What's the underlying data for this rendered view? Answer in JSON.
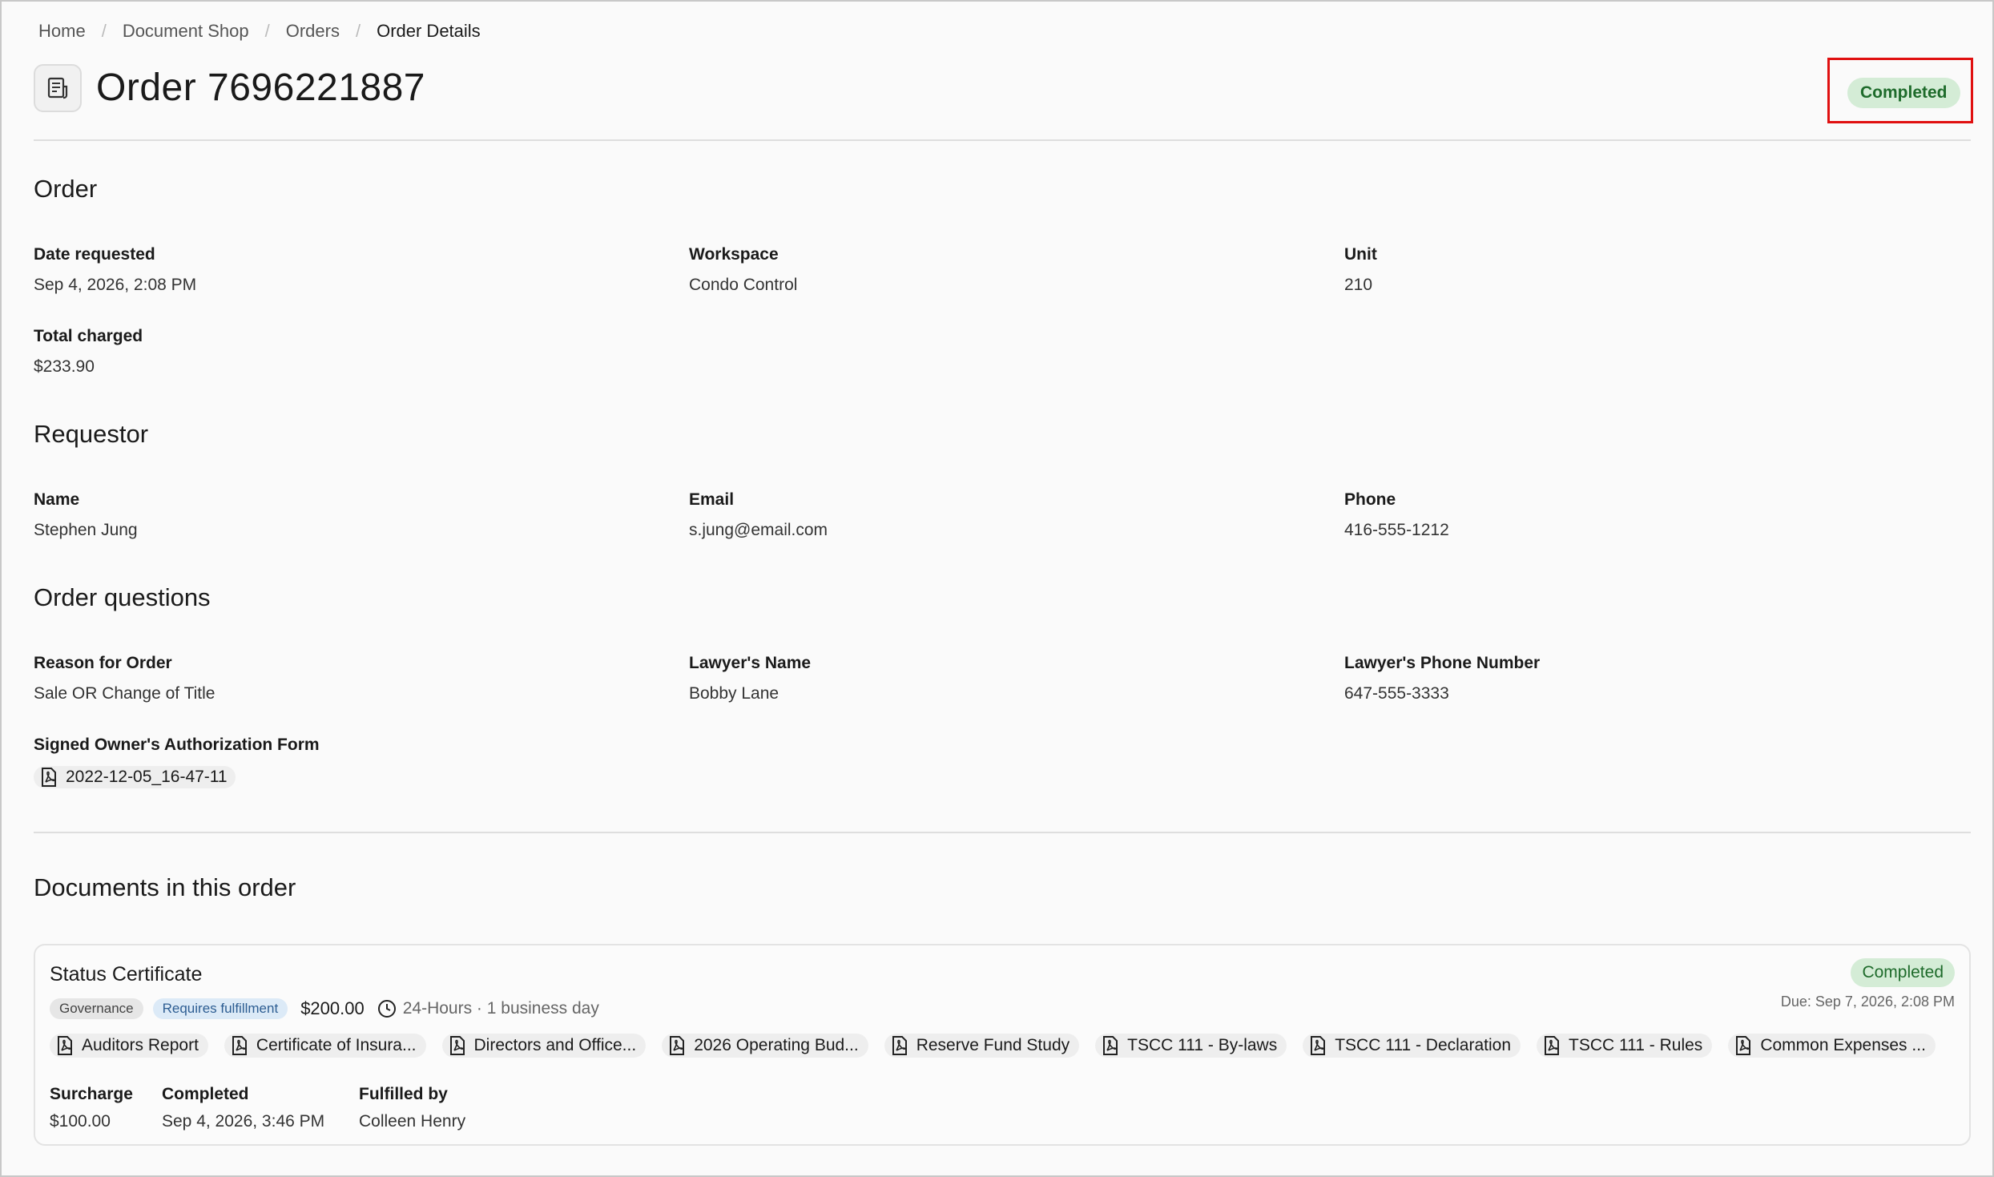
{
  "breadcrumb": {
    "items": [
      "Home",
      "Document Shop",
      "Orders"
    ],
    "current": "Order Details"
  },
  "header": {
    "title": "Order 7696221887",
    "status": "Completed",
    "icon": "document-icon"
  },
  "order": {
    "title": "Order",
    "date_requested": {
      "label": "Date requested",
      "value": "Sep 4, 2026, 2:08 PM"
    },
    "workspace": {
      "label": "Workspace",
      "value": "Condo Control"
    },
    "unit": {
      "label": "Unit",
      "value": "210"
    },
    "total_charged": {
      "label": "Total charged",
      "value": "$233.90"
    }
  },
  "requestor": {
    "title": "Requestor",
    "name": {
      "label": "Name",
      "value": "Stephen Jung"
    },
    "email": {
      "label": "Email",
      "value": "s.jung@email.com"
    },
    "phone": {
      "label": "Phone",
      "value": "416-555-1212"
    }
  },
  "questions": {
    "title": "Order questions",
    "reason": {
      "label": "Reason for Order",
      "value": "Sale OR Change of Title"
    },
    "lawyer_name": {
      "label": "Lawyer's Name",
      "value": "Bobby Lane"
    },
    "lawyer_phone": {
      "label": "Lawyer's Phone Number",
      "value": "647-555-3333"
    },
    "auth_form": {
      "label": "Signed Owner's Authorization Form",
      "file": "2022-12-05_16-47-11"
    }
  },
  "documents": {
    "title": "Documents in this order",
    "card": {
      "title": "Status Certificate",
      "status": "Completed",
      "due": "Due: Sep 7, 2026, 2:08 PM",
      "tag_category": "Governance",
      "tag_fulfillment": "Requires fulfillment",
      "price": "$200.00",
      "turnaround": "24-Hours · 1 business day",
      "files": [
        "Auditors Report",
        "Certificate of Insura...",
        "Directors and Office...",
        "2026 Operating Bud...",
        "Reserve Fund Study",
        "TSCC 111 - By-laws",
        "TSCC 111 - Declaration",
        "TSCC 111 - Rules",
        "Common Expenses ..."
      ],
      "surcharge": {
        "label": "Surcharge",
        "value": "$100.00"
      },
      "completed": {
        "label": "Completed",
        "value": "Sep 4, 2026, 3:46 PM"
      },
      "fulfilled_by": {
        "label": "Fulfilled by",
        "value": "Colleen Henry"
      }
    }
  },
  "colors": {
    "status_bg": "#d4ecd6",
    "status_text": "#1e6b2b",
    "highlight": "#e01010",
    "tag_blue_bg": "#dceaf7"
  }
}
